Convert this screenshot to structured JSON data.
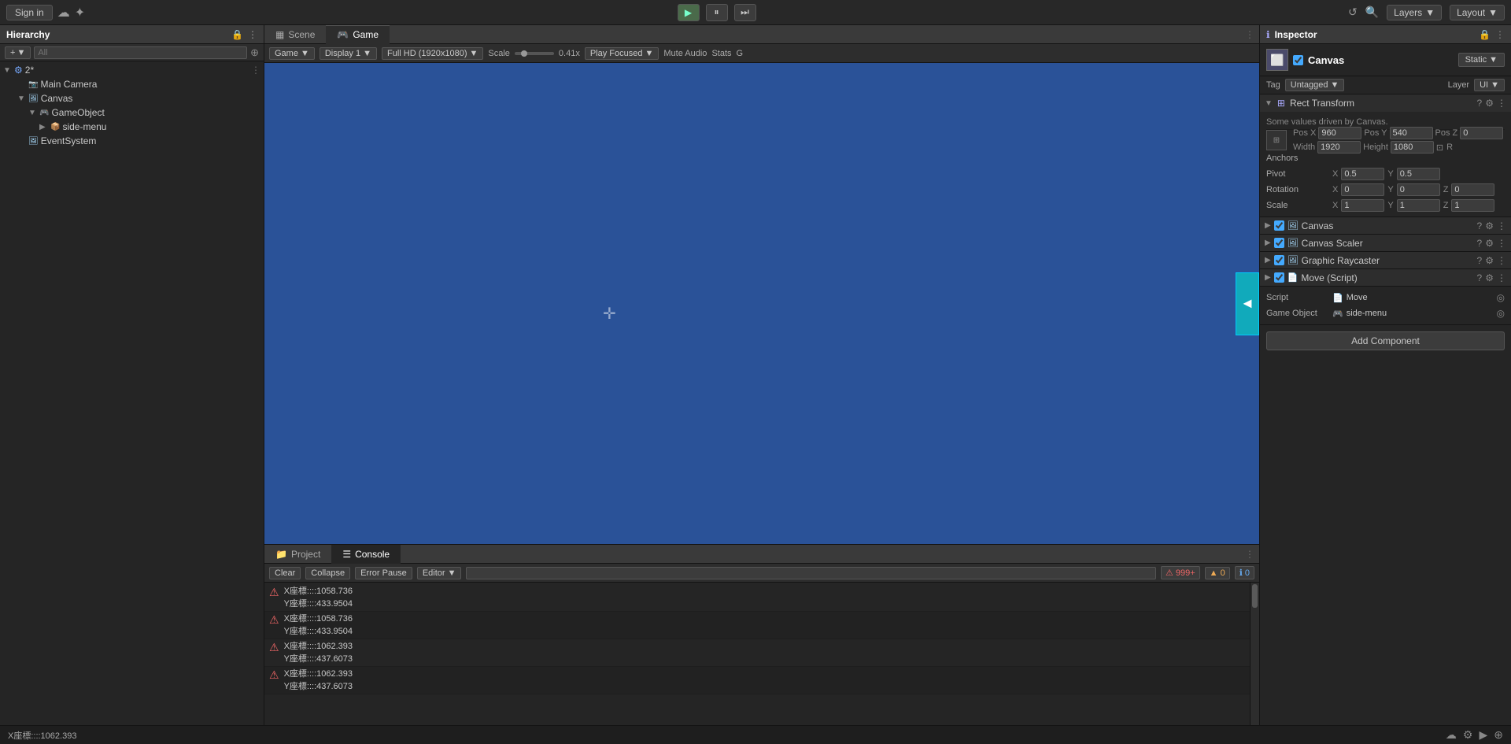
{
  "topbar": {
    "signin_label": "Sign in",
    "play_label": "▶",
    "pause_label": "⏸",
    "step_label": "⏭",
    "layers_label": "Layers",
    "layout_label": "Layout",
    "undo_icon": "↺",
    "search_icon": "🔍"
  },
  "hierarchy": {
    "title": "Hierarchy",
    "add_label": "+",
    "search_placeholder": "All",
    "items": [
      {
        "id": "root",
        "label": "2*",
        "indent": 0,
        "arrow": "▼",
        "icon": "⚙"
      },
      {
        "id": "main-camera",
        "label": "Main Camera",
        "indent": 1,
        "arrow": "",
        "icon": "📷"
      },
      {
        "id": "canvas",
        "label": "Canvas",
        "indent": 1,
        "arrow": "▼",
        "icon": "🖼"
      },
      {
        "id": "gameobject",
        "label": "GameObject",
        "indent": 2,
        "arrow": "▼",
        "icon": "🎮"
      },
      {
        "id": "side-menu",
        "label": "side-menu",
        "indent": 3,
        "arrow": "▶",
        "icon": "📦"
      },
      {
        "id": "eventsystem",
        "label": "EventSystem",
        "indent": 1,
        "arrow": "",
        "icon": "🖼"
      }
    ]
  },
  "tabs": {
    "scene": "Scene",
    "game": "Game"
  },
  "game_toolbar": {
    "game_label": "Game",
    "display_label": "Display 1",
    "resolution_label": "Full HD (1920x1080)",
    "scale_label": "Scale",
    "scale_value": "0.41x",
    "play_focused": "Play Focused",
    "mute_audio": "Mute Audio",
    "stats": "Stats",
    "gizmos": "G"
  },
  "inspector": {
    "title": "Inspector",
    "object_name": "Canvas",
    "static_label": "Static",
    "tag_label": "Tag",
    "tag_value": "Untagged",
    "layer_label": "Layer",
    "layer_value": "UI",
    "rect_transform": {
      "title": "Rect Transform",
      "driven_text": "Some values driven by Canvas.",
      "pos_x_label": "Pos X",
      "pos_y_label": "Pos Y",
      "pos_z_label": "Pos Z",
      "pos_x": "960",
      "pos_y": "540",
      "pos_z": "0",
      "width_label": "Width",
      "height_label": "Height",
      "width": "1920",
      "height": "1080",
      "anchors_label": "Anchors",
      "pivot_label": "Pivot",
      "pivot_x": "0.5",
      "pivot_y": "0.5",
      "rotation_label": "Rotation",
      "rot_x": "0",
      "rot_y": "0",
      "rot_z": "0",
      "scale_label": "Scale",
      "scale_x": "1",
      "scale_y": "1",
      "scale_z": "1"
    },
    "components": [
      {
        "id": "canvas",
        "name": "Canvas",
        "enabled": true
      },
      {
        "id": "canvas-scaler",
        "name": "Canvas Scaler",
        "enabled": true
      },
      {
        "id": "graphic-raycaster",
        "name": "Graphic Raycaster",
        "enabled": true
      },
      {
        "id": "move-script",
        "name": "Move (Script)",
        "enabled": true
      }
    ],
    "move_script": {
      "script_label": "Script",
      "script_value": "Move",
      "gameobj_label": "Game Object",
      "gameobj_value": "side-menu"
    },
    "add_component": "Add Component"
  },
  "console": {
    "project_tab": "Project",
    "console_tab": "Console",
    "clear_label": "Clear",
    "collapse_label": "Collapse",
    "error_pause_label": "Error Pause",
    "editor_label": "Editor",
    "badge_999": "999+",
    "badge_warn": "0",
    "badge_info": "0",
    "messages": [
      {
        "text": "X座標::::1058.736\nY座標::::433.9504"
      },
      {
        "text": "X座標::::1058.736\nY座標::::433.9504"
      },
      {
        "text": "X座標::::1062.393\nY座標::::437.6073"
      },
      {
        "text": "X座標::::1062.393\nY座標::::437.6073"
      }
    ]
  },
  "status_bar": {
    "position_label": "X座標::::1062.393"
  }
}
